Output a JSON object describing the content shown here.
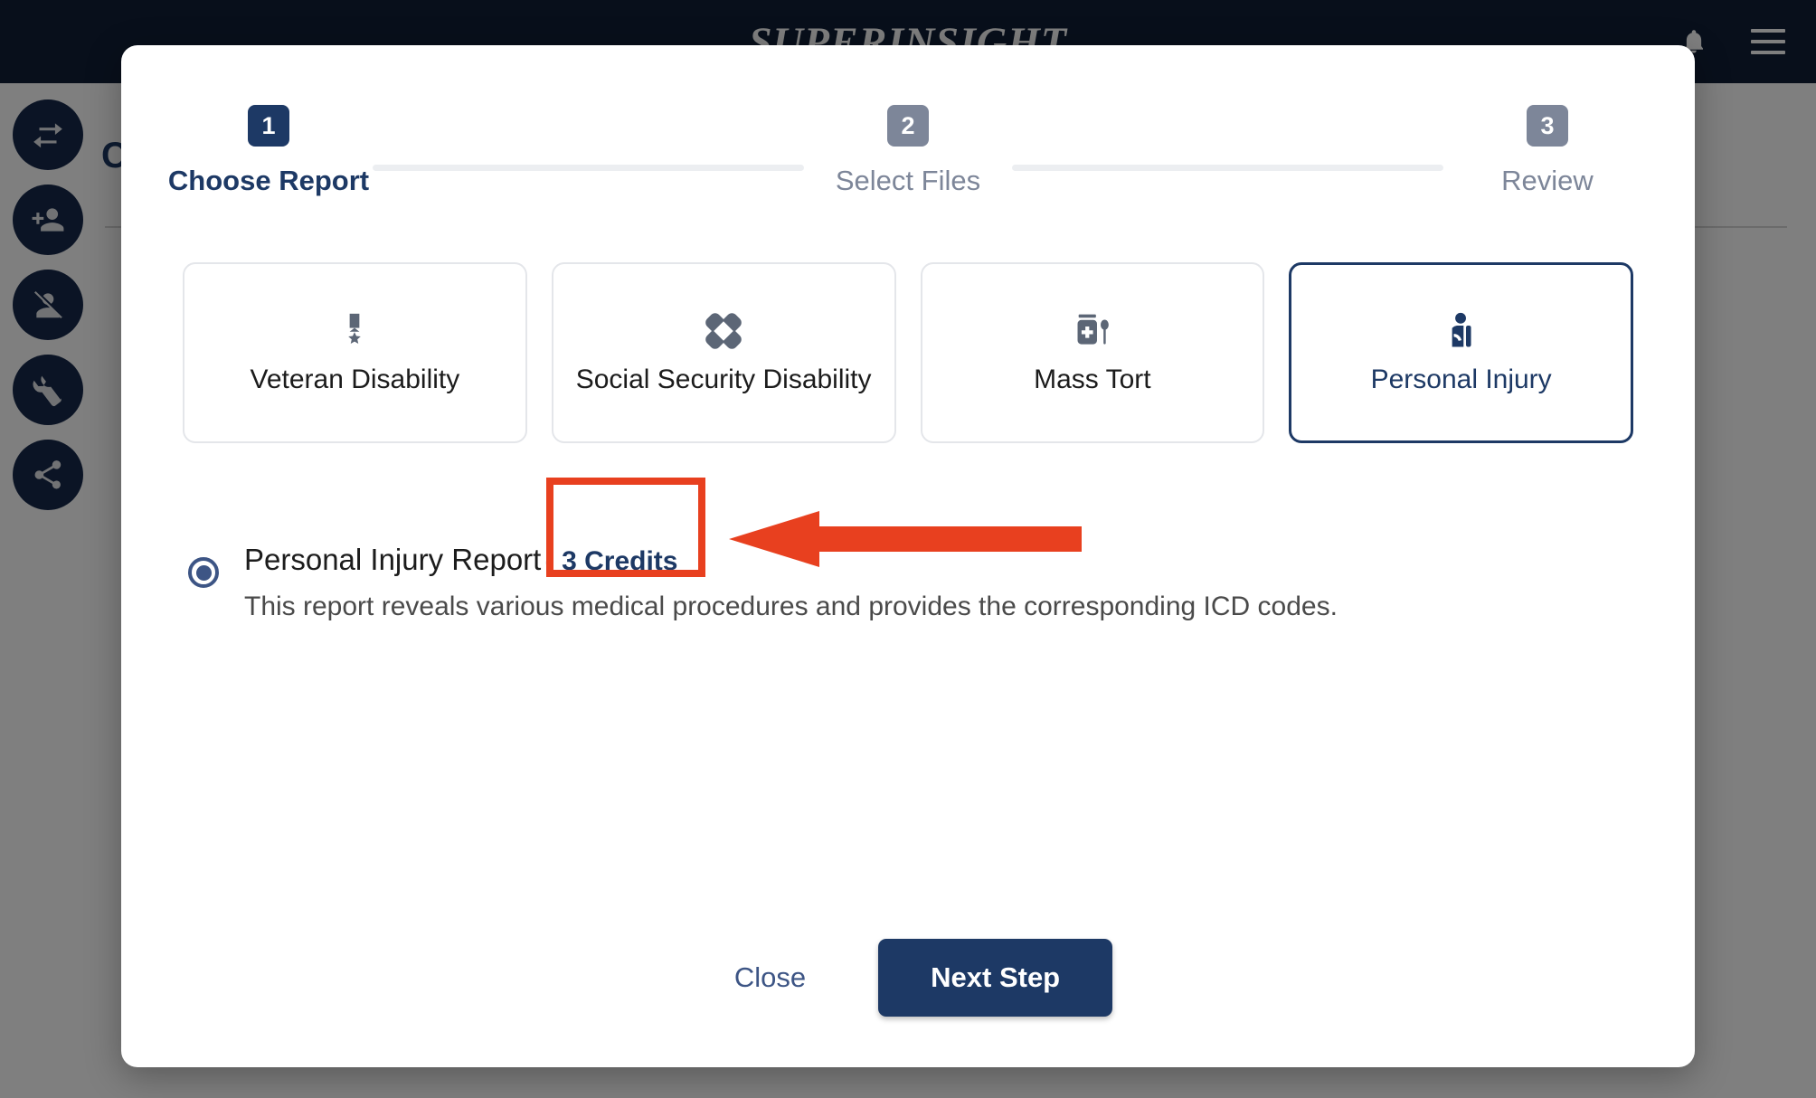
{
  "app": {
    "logo_text": "SUPERINSIGHT",
    "header_bg": "#111f36",
    "content_letter": "C",
    "icons": {
      "bell": "bell-icon",
      "menu": "hamburger-menu-icon"
    },
    "rail_items": [
      {
        "name": "swap-arrows-icon",
        "label": "Swap"
      },
      {
        "name": "person-add-icon",
        "label": "Add Person"
      },
      {
        "name": "person-off-icon",
        "label": "Remove Person"
      },
      {
        "name": "wrench-icon",
        "label": "Tools"
      },
      {
        "name": "share-icon",
        "label": "Share"
      }
    ]
  },
  "modal": {
    "stepper": [
      {
        "number": "1",
        "label": "Choose Report",
        "state": "active"
      },
      {
        "number": "2",
        "label": "Select Files",
        "state": "inactive"
      },
      {
        "number": "3",
        "label": "Review",
        "state": "inactive"
      }
    ],
    "report_types": [
      {
        "label": "Veteran Disability",
        "icon": "military-medal-icon",
        "selected": false
      },
      {
        "label": "Social Security Disability",
        "icon": "crossed-bandages-icon",
        "selected": false
      },
      {
        "label": "Mass Tort",
        "icon": "medicine-jar-spoon-icon",
        "selected": false
      },
      {
        "label": "Personal Injury",
        "icon": "person-arm-sling-icon",
        "selected": true
      }
    ],
    "option": {
      "title": "Personal Injury Report",
      "credits": "- 3 Credits",
      "description": "This report reveals various medical procedures and provides the corresponding ICD codes.",
      "selected": true
    },
    "footer": {
      "close_label": "Close",
      "next_label": "Next Step"
    }
  },
  "annotations": {
    "highlight_color": "#e8401f",
    "box_target": "- 3 Credits",
    "arrow_direction": "left"
  },
  "colors": {
    "navy": "#1d3965",
    "header_navy": "#111f36",
    "muted_gray": "#7d8699",
    "annotation_red": "#e8401f"
  }
}
